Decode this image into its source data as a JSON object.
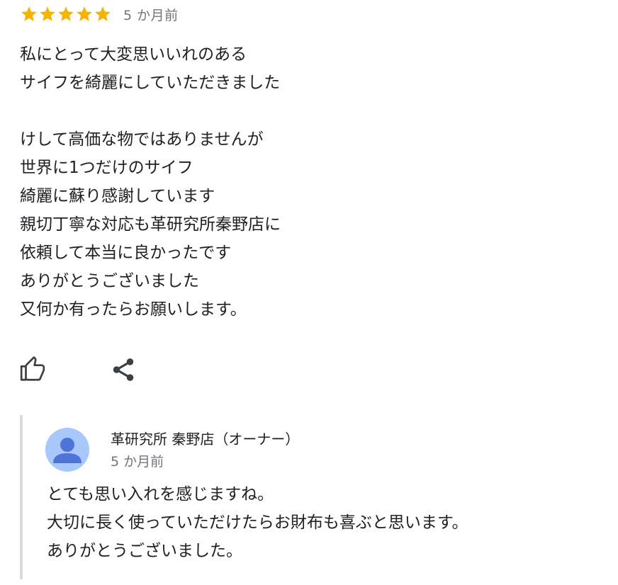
{
  "review": {
    "rating": 5,
    "max_rating": 5,
    "star_color": "#f4b400",
    "time": "5 か月前",
    "lines": [
      "私にとって大変思いいれのある",
      "サイフを綺麗にしていただきました",
      "",
      "けして高価な物ではありませんが",
      "世界に1つだけのサイフ",
      "綺麗に蘇り感謝しています",
      "親切丁寧な対応も革研究所秦野店に",
      "依頼して本当に良かったです",
      "ありがとうございました",
      "又何か有ったらお願いします。"
    ],
    "actions": {
      "like_icon": "thumbs-up-icon",
      "share_icon": "share-icon"
    }
  },
  "owner_reply": {
    "name": "革研究所 秦野店（オーナー）",
    "time": "5 か月前",
    "avatar_icon": "person-icon",
    "avatar_bg": "#a8c7fa",
    "avatar_fg": "#4f74d8",
    "lines": [
      "とても思い入れを感じますね。",
      "大切に長く使っていただけたらお財布も喜ぶと思います。",
      "ありがとうございました。"
    ]
  }
}
